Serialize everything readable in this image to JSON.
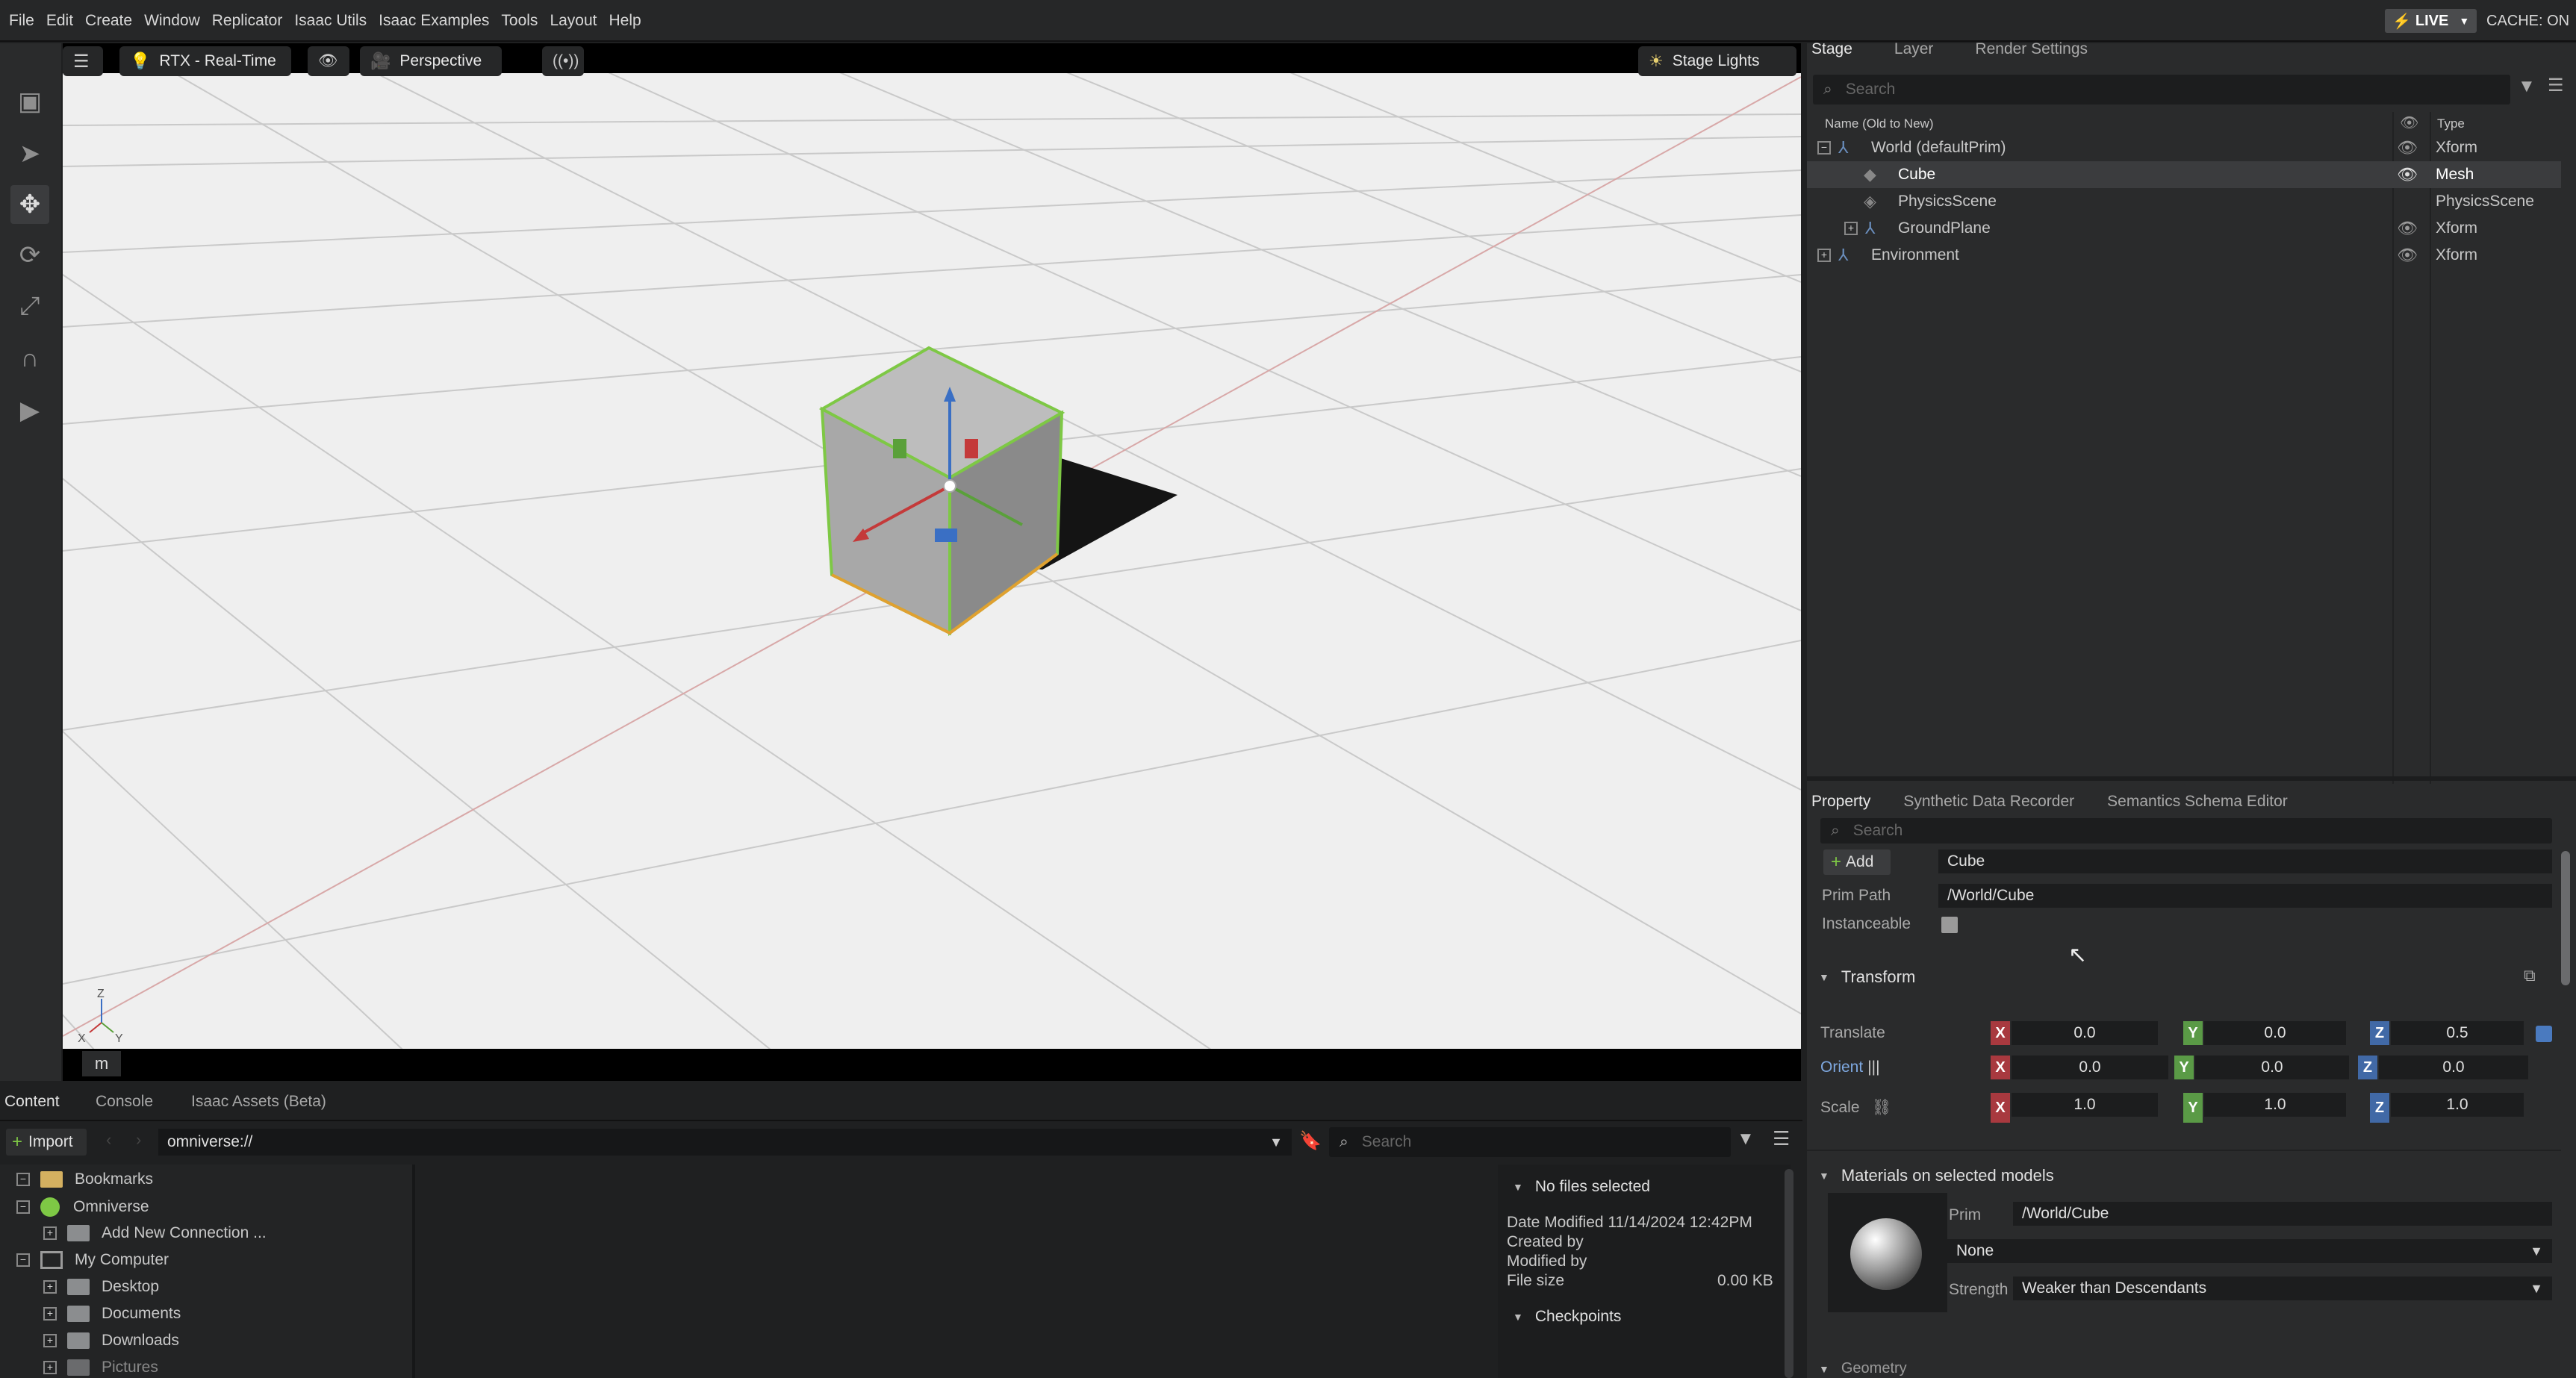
{
  "menubar": {
    "items": [
      "File",
      "Edit",
      "Create",
      "Window",
      "Replicator",
      "Isaac Utils",
      "Isaac Examples",
      "Tools",
      "Layout",
      "Help"
    ],
    "live": "LIVE",
    "cache": "CACHE: ON"
  },
  "viewport": {
    "renderer": "RTX - Real-Time",
    "camera": "Perspective",
    "lights": "Stage Lights",
    "hotkey": "m",
    "axes": {
      "z": "Z",
      "x": "X",
      "y": "Y"
    }
  },
  "stage": {
    "tabs": [
      "Stage",
      "Layer",
      "Render Settings"
    ],
    "search_placeholder": "Search",
    "col_name": "Name (Old to New)",
    "col_type": "Type",
    "rows": [
      {
        "name": "World (defaultPrim)",
        "type": "Xform"
      },
      {
        "name": "Cube",
        "type": "Mesh"
      },
      {
        "name": "PhysicsScene",
        "type": "PhysicsScene"
      },
      {
        "name": "GroundPlane",
        "type": "Xform"
      },
      {
        "name": "Environment",
        "type": "Xform"
      }
    ]
  },
  "property": {
    "tabs": [
      "Property",
      "Synthetic Data Recorder",
      "Semantics Schema Editor"
    ],
    "search_placeholder": "Search",
    "add_label": "Add",
    "name_value": "Cube",
    "prim_path_label": "Prim Path",
    "prim_path_value": "/World/Cube",
    "instanceable_label": "Instanceable",
    "transform_label": "Transform",
    "translate_label": "Translate",
    "orient_label": "Orient",
    "scale_label": "Scale",
    "translate": [
      "0.0",
      "0.0",
      "0.5"
    ],
    "orient": [
      "0.0",
      "0.0",
      "0.0"
    ],
    "scale": [
      "1.0",
      "1.0",
      "1.0"
    ],
    "axis_x": "X",
    "axis_y": "Y",
    "axis_z": "Z",
    "materials_label": "Materials on selected models",
    "prim_label": "Prim",
    "prim_value": "/World/Cube",
    "material_value": "None",
    "strength_label": "Strength",
    "strength_value": "Weaker than Descendants",
    "geometry_label": "Geometry"
  },
  "content": {
    "tabs": [
      "Content",
      "Console",
      "Isaac Assets (Beta)"
    ],
    "import_label": "Import",
    "path_value": "omniverse://",
    "search_placeholder": "Search",
    "tree": [
      "Bookmarks",
      "Omniverse",
      "Add New Connection ...",
      "My Computer",
      "Desktop",
      "Documents",
      "Downloads",
      "Pictures"
    ],
    "details_header": "No files selected",
    "date_modified": "Date Modified 11/14/2024 12:42PM",
    "created_by": "Created by",
    "modified_by": "Modified by",
    "file_size_label": "File size",
    "file_size_value": "0.00 KB",
    "checkpoints": "Checkpoints"
  }
}
